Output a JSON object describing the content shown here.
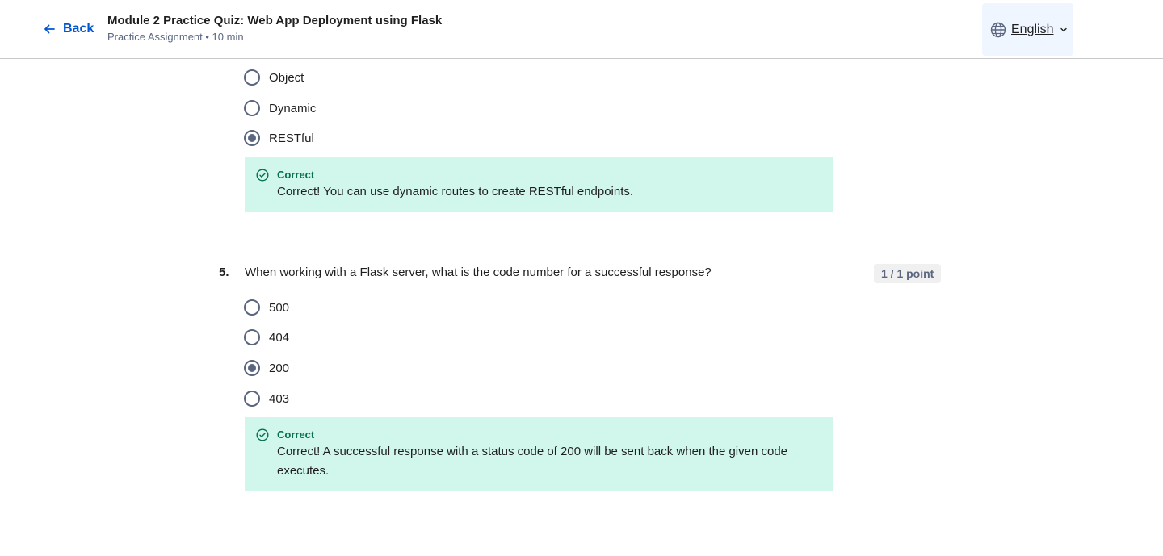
{
  "header": {
    "back_label": "Back",
    "title": "Module 2 Practice Quiz: Web App Deployment using Flask",
    "subtitle": "Practice Assignment • 10 min",
    "language": "English"
  },
  "question4": {
    "options": [
      {
        "label": "Object",
        "selected": false
      },
      {
        "label": "Dynamic",
        "selected": false
      },
      {
        "label": "RESTful",
        "selected": true
      }
    ],
    "feedback": {
      "status": "Correct",
      "text": "Correct! You can use dynamic routes to create RESTful endpoints."
    }
  },
  "question5": {
    "number": "5.",
    "text": "When working with a Flask server, what is the code number for a successful response?",
    "points": "1 / 1 point",
    "options": [
      {
        "label": "500",
        "selected": false
      },
      {
        "label": "404",
        "selected": false
      },
      {
        "label": "200",
        "selected": true
      },
      {
        "label": "403",
        "selected": false
      }
    ],
    "feedback": {
      "status": "Correct",
      "text": "Correct! A successful response with a status code of 200 will be sent back when the given code executes."
    }
  },
  "colors": {
    "accent": "#0056d2",
    "correct_bg": "#d1f7ec",
    "correct_text": "#087051"
  }
}
